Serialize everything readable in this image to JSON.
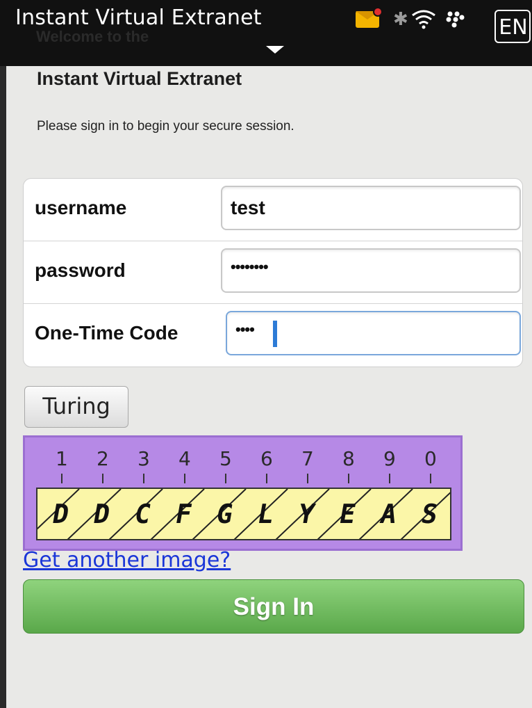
{
  "status_bar": {
    "title": "Instant Virtual Extranet",
    "partially_hidden_text": "Welcome to the",
    "language": "EN",
    "icons": [
      "envelope-icon",
      "bluetooth-icon",
      "wifi-icon",
      "blackberry-icon",
      "menu-caret-icon"
    ]
  },
  "page": {
    "heading": "Instant Virtual Extranet",
    "subtext": "Please sign in to begin your secure session."
  },
  "form": {
    "username_label": "username",
    "username_value": "test",
    "password_label": "password",
    "password_value": "••••••••",
    "otc_label": "One-Time Code",
    "otc_value": "••••"
  },
  "captcha": {
    "button_label": "Turing",
    "numbers": [
      "1",
      "2",
      "3",
      "4",
      "5",
      "6",
      "7",
      "8",
      "9",
      "0"
    ],
    "characters": [
      "D",
      "D",
      "C",
      "F",
      "G",
      "L",
      "Y",
      "E",
      "A",
      "S"
    ],
    "another_link": "Get another image?"
  },
  "signin": {
    "label": "Sign In"
  },
  "colors": {
    "status_bar": "#111111",
    "background": "#e9e9e7",
    "captcha_bg": "#b689e6",
    "captcha_strip": "#fbf6a8",
    "signin_green": "#5aa84a",
    "link": "#1a36d8"
  }
}
